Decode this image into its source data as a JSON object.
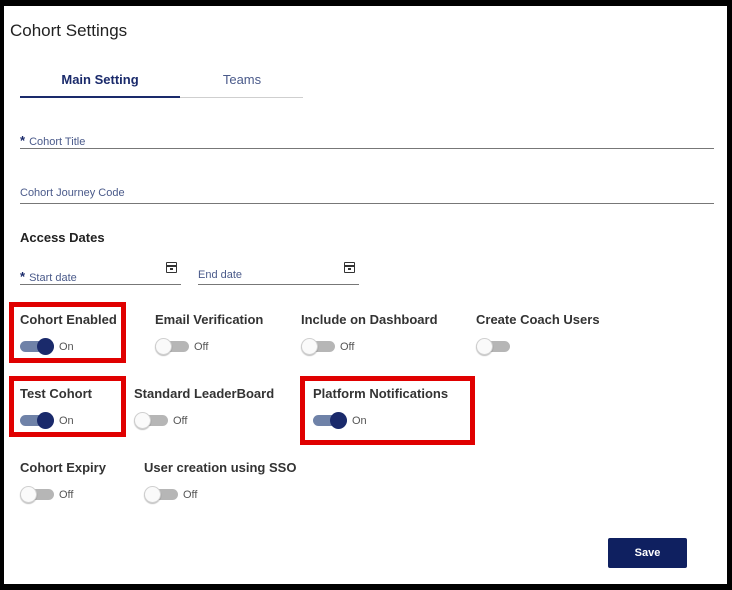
{
  "page": {
    "title": "Cohort Settings"
  },
  "tabs": [
    {
      "label": "Main Setting",
      "active": true
    },
    {
      "label": "Teams",
      "active": false
    }
  ],
  "form": {
    "cohort_title": {
      "label": "Cohort Title",
      "required": true,
      "value": ""
    },
    "journey_code": {
      "label": "Cohort Journey Code",
      "required": false,
      "value": ""
    },
    "access_dates_heading": "Access Dates",
    "start_date": {
      "label": "Start date",
      "required": true,
      "value": ""
    },
    "end_date": {
      "label": "End date",
      "required": false,
      "value": ""
    },
    "required_mark": "*"
  },
  "toggles": {
    "cohort_enabled": {
      "label": "Cohort Enabled",
      "state": "On"
    },
    "email_verification": {
      "label": "Email Verification",
      "state": "Off"
    },
    "include_on_dashboard": {
      "label": "Include on Dashboard",
      "state": "Off"
    },
    "create_coach_users": {
      "label": "Create Coach Users",
      "state": ""
    },
    "test_cohort": {
      "label": "Test Cohort",
      "state": "On"
    },
    "standard_leaderboard": {
      "label": "Standard LeaderBoard",
      "state": "Off"
    },
    "platform_notifications": {
      "label": "Platform Notifications",
      "state": "On"
    },
    "cohort_expiry": {
      "label": "Cohort Expiry",
      "state": "Off"
    },
    "sso_user_creation": {
      "label": "User creation using SSO",
      "state": "Off"
    }
  },
  "actions": {
    "save_label": "Save"
  },
  "colors": {
    "primary": "#1a2a6b",
    "save_button": "#0f2060",
    "highlight_box": "#e00000",
    "toggle_on_track": "#6f82a8",
    "toggle_off_track": "#b6b6b6"
  }
}
